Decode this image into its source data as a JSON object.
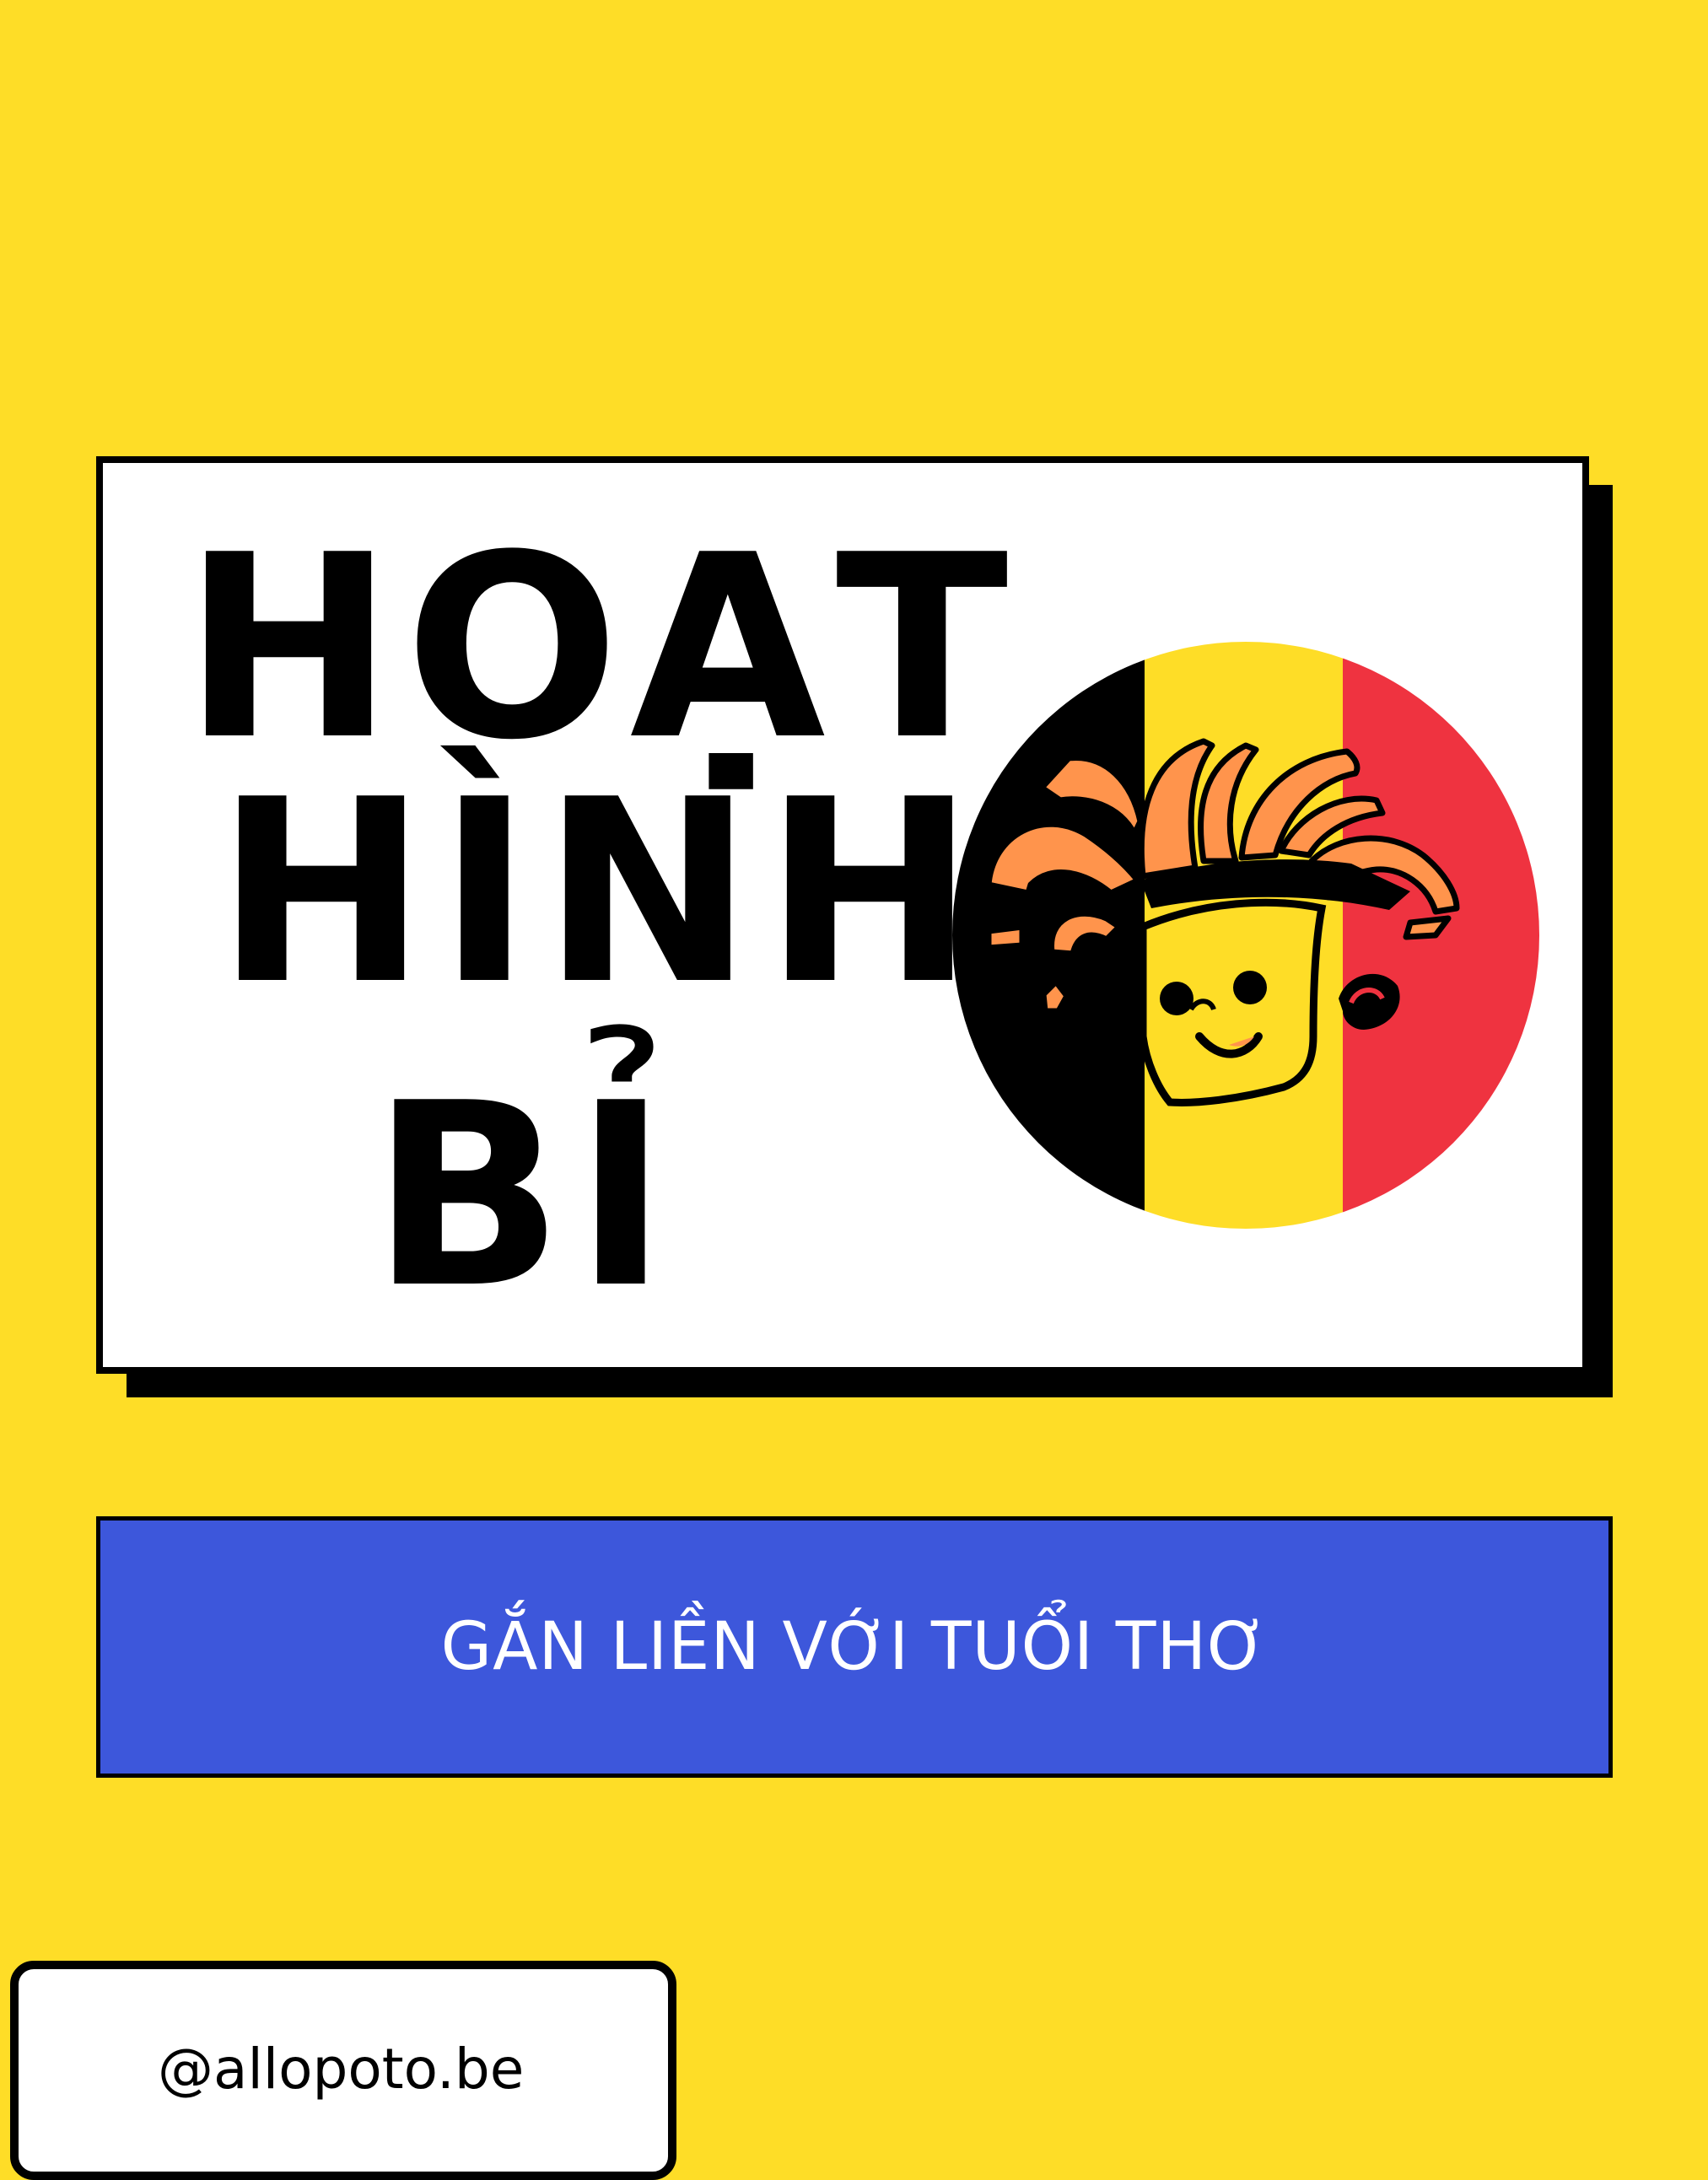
{
  "title": {
    "line_1": "HOẠT",
    "line_2": "HÌNH",
    "line_3": "BỈ"
  },
  "badge": {
    "icon": "belgian-mascot-icon",
    "flag_colors": [
      "#000000",
      "#FEDD27",
      "#EF3340"
    ]
  },
  "subtitle": "GẮN LIỀN VỚI TUỔI THƠ",
  "handle": "@allopoto.be",
  "colors": {
    "background": "#FEDD27",
    "banner": "#3D57DB",
    "card": "#FFFFFF",
    "accent_orange": "#FF944C"
  }
}
